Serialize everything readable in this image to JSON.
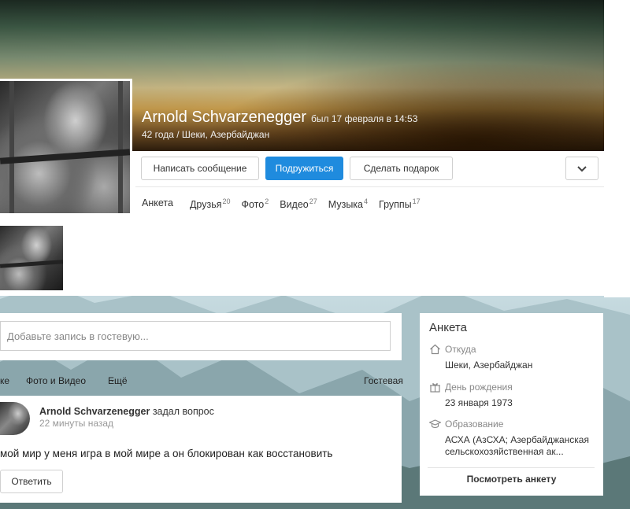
{
  "profile": {
    "name": "Arnold Schvarzenegger",
    "last_seen": "был 17 февраля в 14:53",
    "location": "42 года / Шеки, Азербайджан"
  },
  "actions": {
    "message": "Написать сообщение",
    "add_friend": "Подружиться",
    "gift": "Сделать подарок",
    "more_icon": "chevron-down-icon"
  },
  "tabs": [
    {
      "label": "Анкета",
      "count": ""
    },
    {
      "label": "Друзья",
      "count": "20"
    },
    {
      "label": "Фото",
      "count": "2"
    },
    {
      "label": "Видео",
      "count": "27"
    },
    {
      "label": "Музыка",
      "count": "4"
    },
    {
      "label": "Группы",
      "count": "17"
    }
  ],
  "guestbook": {
    "placeholder": "Добавьте запись в гостевую..."
  },
  "feed_tabs": {
    "tab1": "ке",
    "tab2": "Фото и Видео",
    "more": "Ещё",
    "guest": "Гостевая"
  },
  "post": {
    "author": "Arnold Schvarzenegger",
    "action": "задал вопрос",
    "time": "22 минуты назад",
    "text": "мой мир у меня игра в мой мире а он блокирован как восстановить",
    "reply": "Ответить"
  },
  "sidebar": {
    "title": "Анкета",
    "from_label": "Откуда",
    "from_value": "Шеки, Азербайджан",
    "birthday_label": "День рождения",
    "birthday_value": "23 января 1973",
    "education_label": "Образование",
    "education_value_1": "АСХА (АзСХА; Азербайджанская",
    "education_value_2": "сельскохозяйственная ак...",
    "view_profile": "Посмотреть анкету"
  },
  "colors": {
    "primary_button": "#1f8bde",
    "text": "#333333",
    "muted": "#888888"
  }
}
